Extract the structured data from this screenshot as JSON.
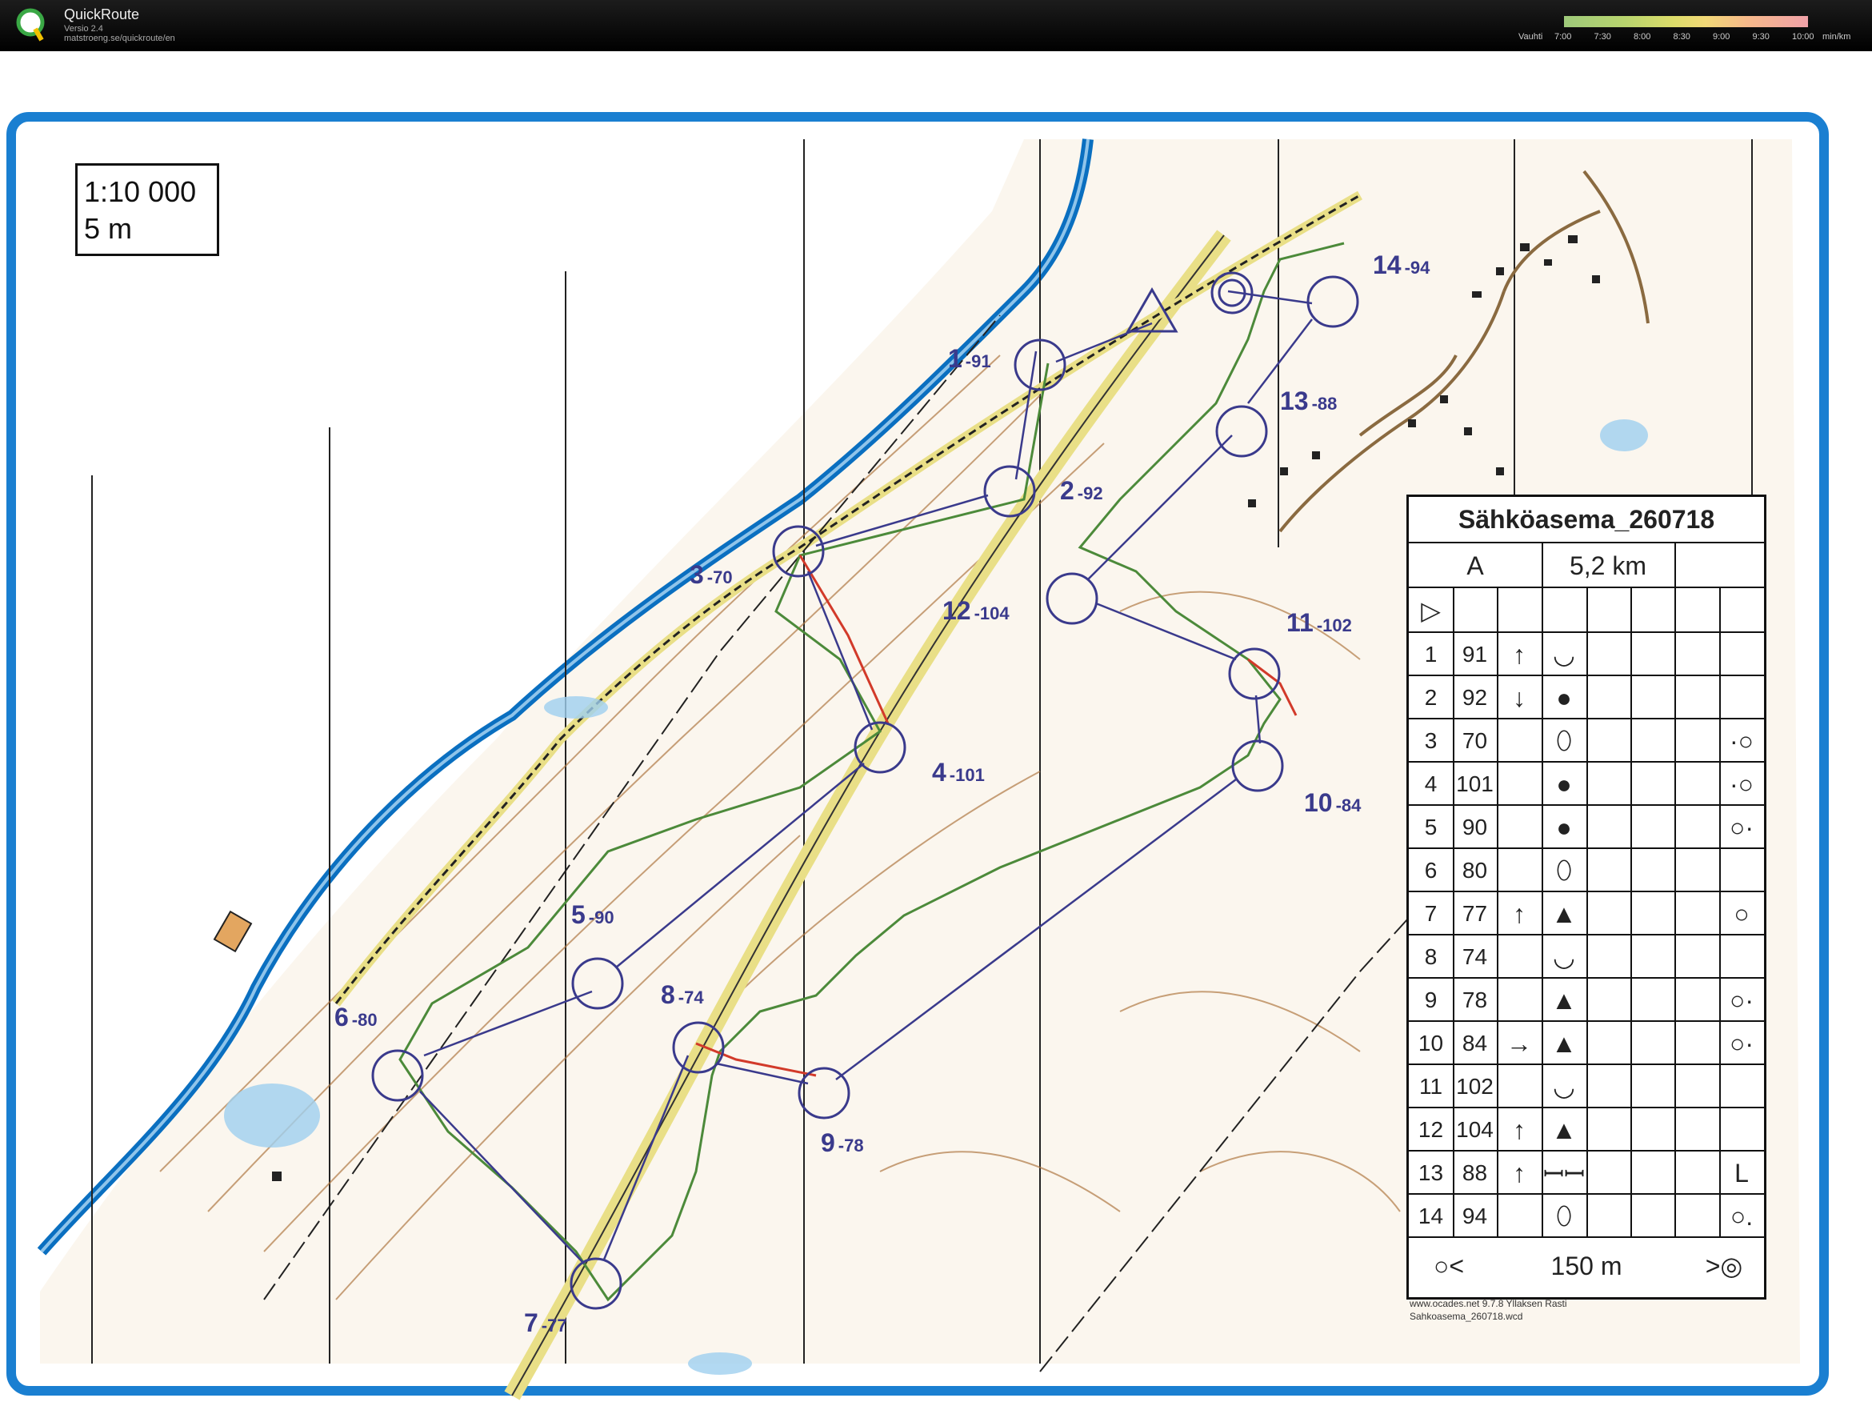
{
  "app": {
    "title": "QuickRoute",
    "version": "Versio 2.4",
    "url": "matstroeng.se/quickroute/en"
  },
  "pace_legend": {
    "label": "Vauhti",
    "ticks": [
      "7:00",
      "7:30",
      "8:00",
      "8:30",
      "9:00",
      "9:30",
      "10:00"
    ],
    "unit": "min/km"
  },
  "map": {
    "scale": "1:10 000",
    "contour": "5 m",
    "course_name": "Sähköasema_260718",
    "class": "A",
    "length": "5,2 km",
    "credit_line1": "www.ocades.net 9.7.8 Yllaksen Rasti",
    "credit_line2": "Sahkoasema_260718.wcd",
    "control_labels": [
      {
        "num": "1",
        "code": "91"
      },
      {
        "num": "2",
        "code": "92"
      },
      {
        "num": "3",
        "code": "70"
      },
      {
        "num": "4",
        "code": "101"
      },
      {
        "num": "5",
        "code": "90"
      },
      {
        "num": "6",
        "code": "80"
      },
      {
        "num": "7",
        "code": "77"
      },
      {
        "num": "8",
        "code": "74"
      },
      {
        "num": "9",
        "code": "78"
      },
      {
        "num": "10",
        "code": "84"
      },
      {
        "num": "11",
        "code": "102"
      },
      {
        "num": "12",
        "code": "104"
      },
      {
        "num": "13",
        "code": "88"
      },
      {
        "num": "14",
        "code": "94"
      }
    ],
    "finish_text": "150 m",
    "colors": {
      "course": "#3a3a8c",
      "water": "#0a6fc0",
      "route_green": "#4c8a3a",
      "route_red": "#d23a2a",
      "contour": "#b07a45",
      "frame": "#1a7fd1"
    }
  },
  "description_rows": [
    {
      "num": "1",
      "code": "91",
      "dir": "↑",
      "feature": "◡",
      "loc": ""
    },
    {
      "num": "2",
      "code": "92",
      "dir": "↓",
      "feature": "●",
      "loc": ""
    },
    {
      "num": "3",
      "code": "70",
      "dir": "",
      "feature": "⬯",
      "loc": "·○"
    },
    {
      "num": "4",
      "code": "101",
      "dir": "",
      "feature": "●",
      "loc": "·○"
    },
    {
      "num": "5",
      "code": "90",
      "dir": "",
      "feature": "●",
      "loc": "○·"
    },
    {
      "num": "6",
      "code": "80",
      "dir": "",
      "feature": "⬯",
      "loc": ""
    },
    {
      "num": "7",
      "code": "77",
      "dir": "↑",
      "feature": "▲",
      "loc": "○"
    },
    {
      "num": "8",
      "code": "74",
      "dir": "",
      "feature": "◡",
      "loc": ""
    },
    {
      "num": "9",
      "code": "78",
      "dir": "",
      "feature": "▲",
      "loc": "○·"
    },
    {
      "num": "10",
      "code": "84",
      "dir": "→",
      "feature": "▲",
      "loc": "○·"
    },
    {
      "num": "11",
      "code": "102",
      "dir": "",
      "feature": "◡",
      "loc": ""
    },
    {
      "num": "12",
      "code": "104",
      "dir": "↑",
      "feature": "▲",
      "loc": ""
    },
    {
      "num": "13",
      "code": "88",
      "dir": "↑",
      "feature": "ꟷꟷ",
      "loc": "L"
    },
    {
      "num": "14",
      "code": "94",
      "dir": "",
      "feature": "⬯",
      "loc": "○."
    }
  ]
}
